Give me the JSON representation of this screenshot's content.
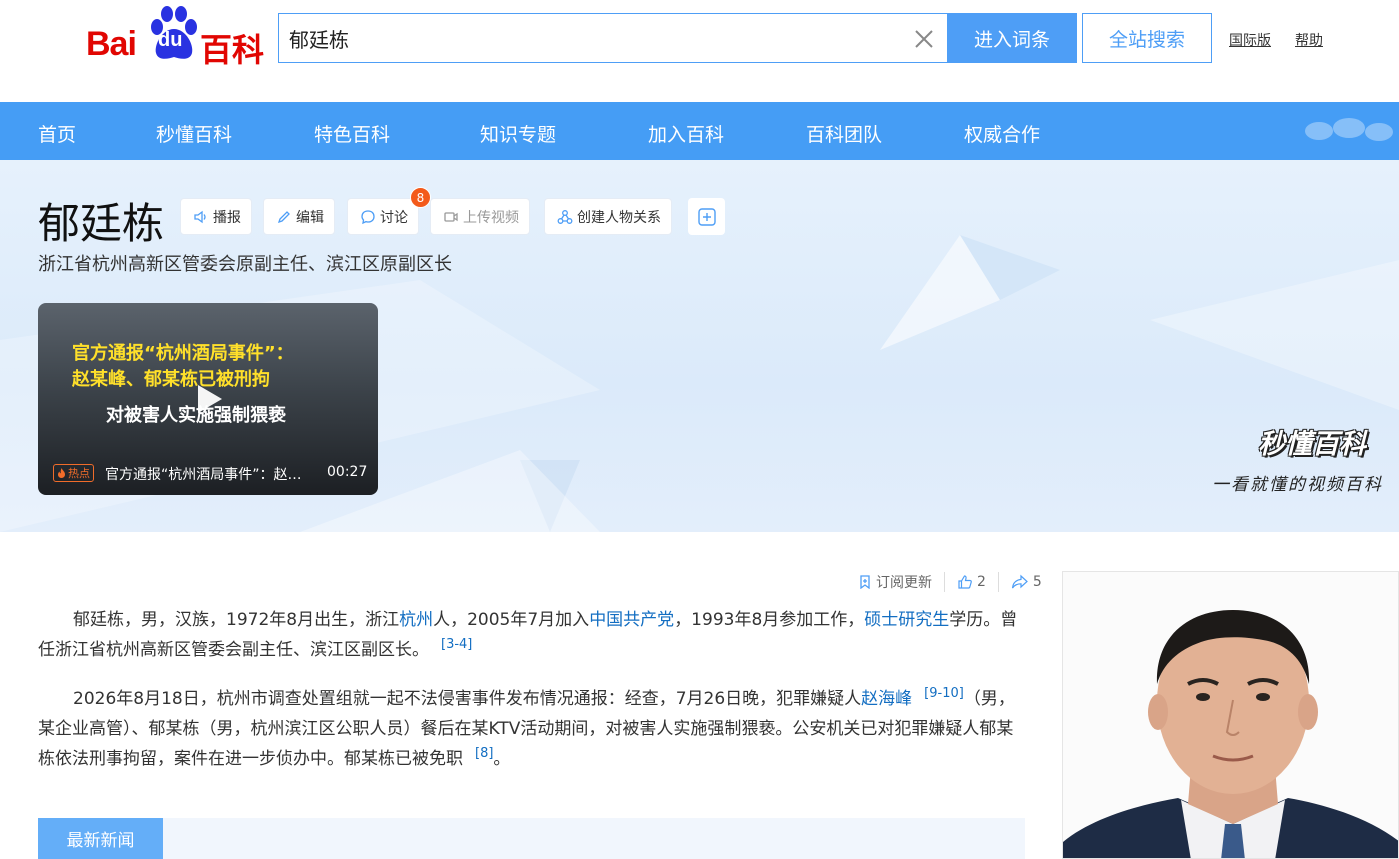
{
  "header": {
    "logo": {
      "bai": "Bai",
      "du": "du",
      "baike": "百科"
    },
    "search_value": "郁廷栋",
    "enter_button": "进入词条",
    "site_search_button": "全站搜索",
    "international_link": "国际版",
    "help_link": "帮助"
  },
  "nav": {
    "items": [
      "首页",
      "秒懂百科",
      "特色百科",
      "知识专题",
      "加入百科",
      "百科团队",
      "权威合作"
    ]
  },
  "entry": {
    "title": "郁廷栋",
    "tools": {
      "broadcast": "播报",
      "edit": "编辑",
      "discuss": "讨论",
      "discuss_count": "8",
      "upload_video": "上传视频",
      "create_relation": "创建人物关系"
    },
    "subtitle": "浙江省杭州高新区管委会原副主任、滨江区原副区长"
  },
  "video": {
    "line1": "官方通报“杭州酒局事件”：",
    "line2": "赵某峰、郁某栋已被刑拘",
    "line3": "对被害人实施强制猥亵",
    "hot_label": "热点",
    "title": "官方通报“杭州酒局事件”：赵某峰、郁某栋已被刑拘",
    "duration": "00:27"
  },
  "miaodong": {
    "logo": "秒懂百科",
    "slogan": "一看就懂的视频百科"
  },
  "actions": {
    "subscribe": "订阅更新",
    "likes": "2",
    "shares": "5"
  },
  "summary": {
    "p1": {
      "t1": "郁廷栋，男，汉族，1972年8月出生，浙江",
      "link1": "杭州",
      "t2": "人，2005年7月加入",
      "link2": "中国共产党",
      "t3": "，1993年8月参加工作，",
      "link3": "硕士研究生",
      "t4": "学历。曾任浙江省杭州高新区管委会副主任、滨江区副区长。",
      "ref": "[3-4]"
    },
    "p2": {
      "t1": "2026年8月18日，杭州市调查处置组就一起不法侵害事件发布情况通报：经查，7月26日晚，犯罪嫌疑人",
      "link1": "赵海峰",
      "ref1": "[9-10]",
      "t2": "（男，某企业高管）、郁某栋（男，杭州滨江区公职人员）餐后在某KTV活动期间，对被害人实施强制猥亵。公安机关已对犯罪嫌疑人郁某栋依法刑事拘留，案件在进一步侦办中。郁某栋已被免职",
      "ref2": "[8]",
      "t3": "。"
    }
  },
  "news": {
    "tab": "最新新闻"
  },
  "colors": {
    "brand_blue": "#4e9ef6",
    "nav_blue": "#459df5",
    "link": "#136ec2",
    "badge": "#f35a1b",
    "logo_red": "#e10602"
  }
}
